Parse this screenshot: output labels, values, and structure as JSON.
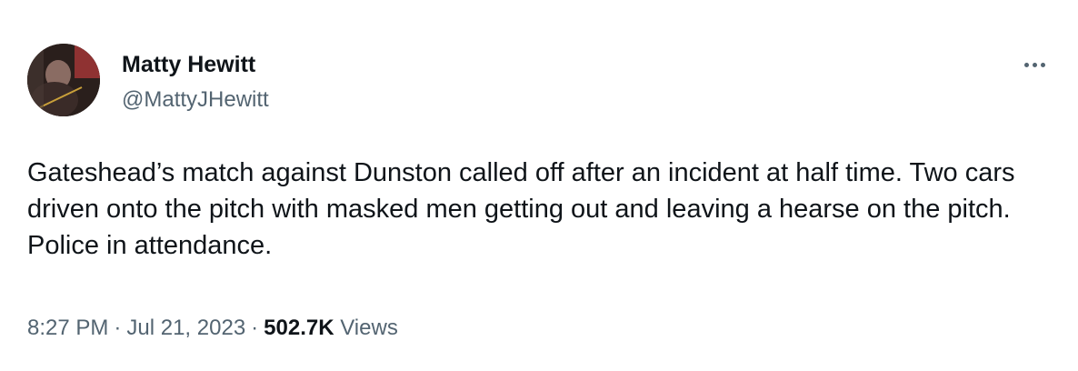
{
  "tweet": {
    "author_name": "Matty Hewitt",
    "author_handle": "@MattyJHewitt",
    "text": "Gateshead’s match against Dunston called off after an incident at half time. Two cars driven onto the pitch with masked men getting out and leaving a hearse on the pitch. Police in attendance.",
    "time": "8:27 PM",
    "separator": "·",
    "date": "Jul 21, 2023",
    "views_count": "502.7K",
    "views_label": "Views"
  },
  "icons": {
    "more": "more-options-icon",
    "avatar": "avatar"
  },
  "colors": {
    "primary_text": "#0f1419",
    "secondary_text": "#536471",
    "background": "#ffffff"
  }
}
